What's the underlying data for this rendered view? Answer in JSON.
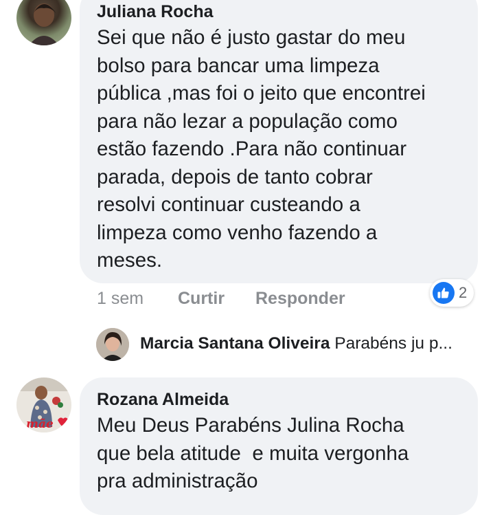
{
  "comments": [
    {
      "author": "Juliana Rocha",
      "lines": [
        "Sei que não é justo gastar do meu",
        "bolso para bancar uma limpeza",
        "pública ,mas foi o jeito que encontrei",
        "para não lezar a população como",
        "estão fazendo .Para não continuar",
        "parada, depois de tanto cobrar",
        "resolvi continuar custeando a",
        "limpeza como venho fazendo a",
        "meses."
      ],
      "time": "1 sem",
      "like_label": "Curtir",
      "reply_label": "Responder",
      "reaction_count": "2",
      "reaction_icon": "thumbs-up-icon"
    },
    {
      "author": "Rozana Almeida",
      "lines": [
        "Meu Deus Parabéns Julina Rocha",
        "que bela atitude  e muita vergonha",
        "pra administração"
      ],
      "avatar_text": "mãe"
    }
  ],
  "reply": {
    "author": "Marcia Santana Oliveira",
    "preview": "Parabéns ju p..."
  },
  "colors": {
    "bubble": "#f0f2f5",
    "meta_text": "#8a8d91",
    "like_blue": "#1877f2"
  }
}
